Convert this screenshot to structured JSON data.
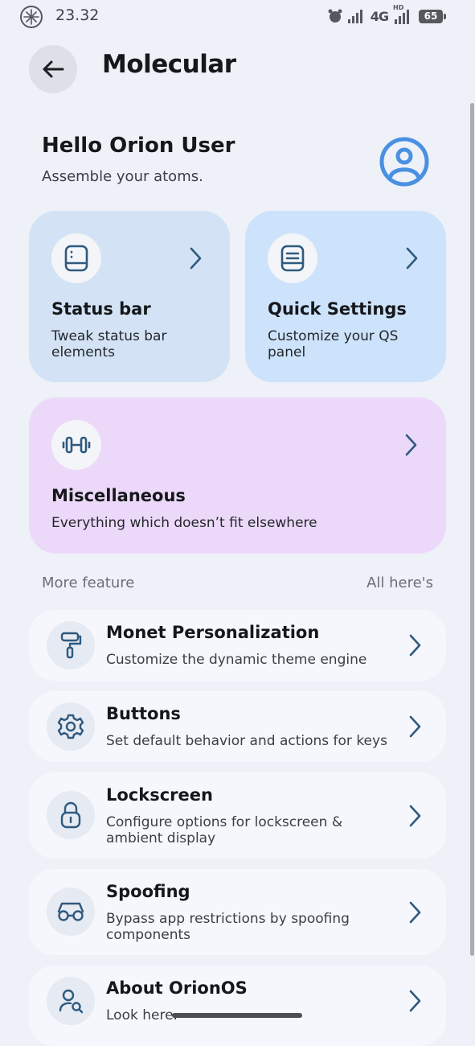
{
  "status_bar": {
    "time": "23.32",
    "network": "4G",
    "hd_badge": "HD",
    "battery": "65"
  },
  "header": {
    "title": "Molecular"
  },
  "greeting": {
    "title": "Hello Orion User",
    "subtitle": "Assemble your atoms."
  },
  "cards": {
    "status_bar": {
      "title": "Status bar",
      "description": "Tweak status bar elements",
      "icon": "phone-icon"
    },
    "quick_settings": {
      "title": "Quick Settings",
      "description": "Customize your QS panel",
      "icon": "qs-tile-icon"
    },
    "misc": {
      "title": "Miscellaneous",
      "description": "Everything which doesn’t fit elsewhere",
      "icon": "dumbbell-icon"
    }
  },
  "section": {
    "left": "More feature",
    "right": "All here's"
  },
  "items": [
    {
      "title": "Monet Personalization",
      "description": "Customize the dynamic theme engine",
      "icon": "paint-roller-icon"
    },
    {
      "title": "Buttons",
      "description": "Set default behavior and actions for keys",
      "icon": "gear-icon"
    },
    {
      "title": "Lockscreen",
      "description": "Configure options for lockscreen & ambient display",
      "icon": "lock-icon"
    },
    {
      "title": "Spoofing",
      "description": "Bypass app restrictions by spoofing components",
      "icon": "glasses-icon"
    },
    {
      "title": "About OrionOS",
      "description": "Look here.",
      "icon": "user-search-icon"
    }
  ],
  "colors": {
    "accent": "#4a90e2",
    "card_status": "#d3e3f5",
    "card_qs": "#cde3fb",
    "card_misc": "#ecd9f9",
    "background": "#eef1f8"
  }
}
